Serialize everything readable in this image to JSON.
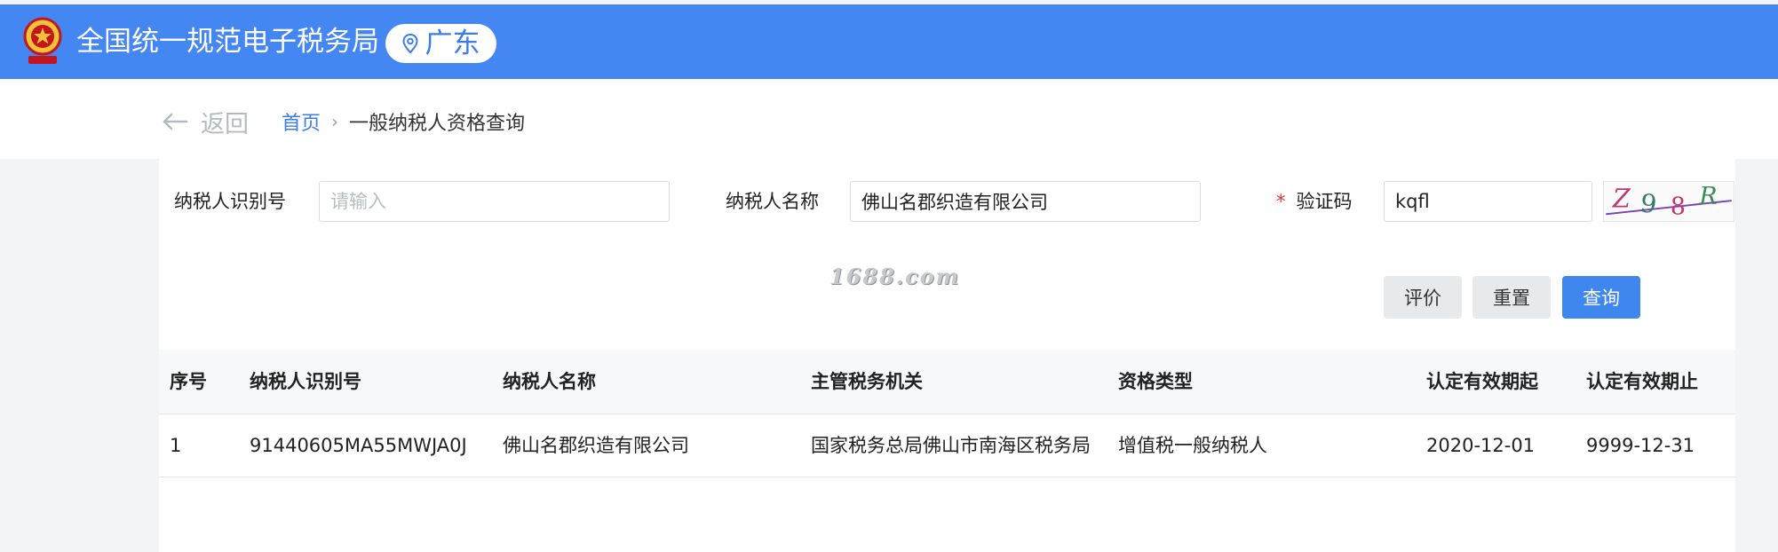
{
  "header": {
    "site_title": "全国统一规范电子税务局",
    "region": "广东",
    "emblem_icon": "national-tax-emblem",
    "region_icon": "location-pin-icon",
    "brand_color": "#4487f2"
  },
  "nav": {
    "back_label": "返回",
    "breadcrumb_home": "首页",
    "breadcrumb_current": "一般纳税人资格查询"
  },
  "form": {
    "taxpayer_id_label": "纳税人识别号",
    "taxpayer_id_placeholder": "请输入",
    "taxpayer_id_value": "",
    "taxpayer_name_label": "纳税人名称",
    "taxpayer_name_value": "佛山名郡织造有限公司",
    "captcha_required_mark": "*",
    "captcha_label": "验证码",
    "captcha_value": "kqfl",
    "captcha_image_text": "Z98R"
  },
  "watermark": "1688.com",
  "buttons": {
    "evaluate": "评价",
    "reset": "重置",
    "query": "查询"
  },
  "table": {
    "headers": [
      "序号",
      "纳税人识别号",
      "纳税人名称",
      "主管税务机关",
      "资格类型",
      "认定有效期起",
      "认定有效期止"
    ],
    "rows": [
      [
        "1",
        "91440605MA55MWJA0J",
        "佛山名郡织造有限公司",
        "国家税务总局佛山市南海区税务局",
        "增值税一般纳税人",
        "2020-12-01",
        "9999-12-31"
      ]
    ]
  }
}
